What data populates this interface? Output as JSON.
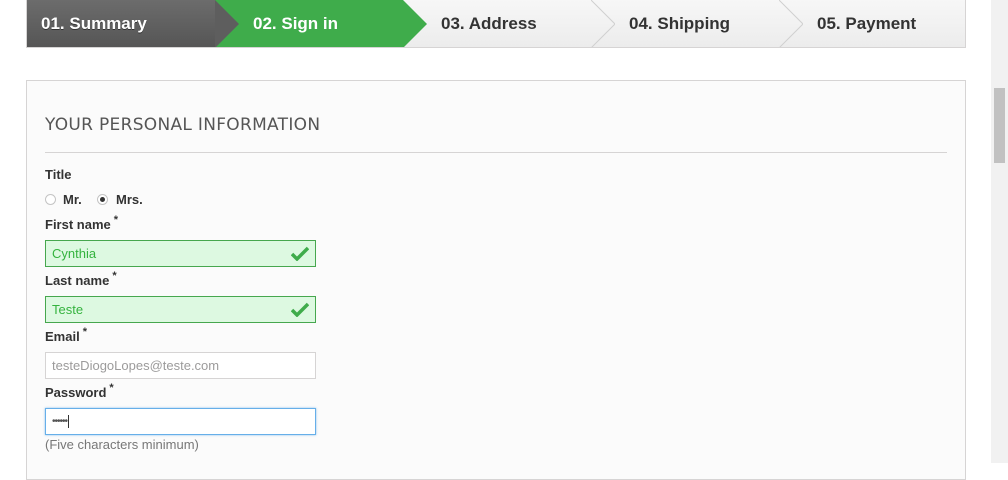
{
  "steps": [
    {
      "label": "01. Summary",
      "state": "done"
    },
    {
      "label": "02. Sign in",
      "state": "current"
    },
    {
      "label": "03. Address",
      "state": "todo"
    },
    {
      "label": "04. Shipping",
      "state": "todo"
    },
    {
      "label": "05. Payment",
      "state": "todo"
    }
  ],
  "colors": {
    "step_done": "#5e5e5e",
    "step_current": "#3fac4b",
    "valid_bg": "#ddf9e1",
    "valid_border": "#46a74e",
    "valid_text": "#35b33f",
    "focus_border": "#66afe9"
  },
  "form": {
    "heading": "YOUR PERSONAL INFORMATION",
    "title_label": "Title",
    "title_options": [
      {
        "label": "Mr.",
        "checked": false
      },
      {
        "label": "Mrs.",
        "checked": true
      }
    ],
    "required_mark": "*",
    "first_name": {
      "label": "First name",
      "value": "Cynthia",
      "status": "valid",
      "icon": "check-icon"
    },
    "last_name": {
      "label": "Last name",
      "value": "Teste",
      "status": "valid",
      "icon": "check-icon"
    },
    "email": {
      "label": "Email",
      "value": "testeDiogoLopes@teste.com",
      "status": "disabled"
    },
    "password": {
      "label": "Password",
      "value": "••••••",
      "status": "focused",
      "hint": "(Five characters minimum)"
    }
  }
}
